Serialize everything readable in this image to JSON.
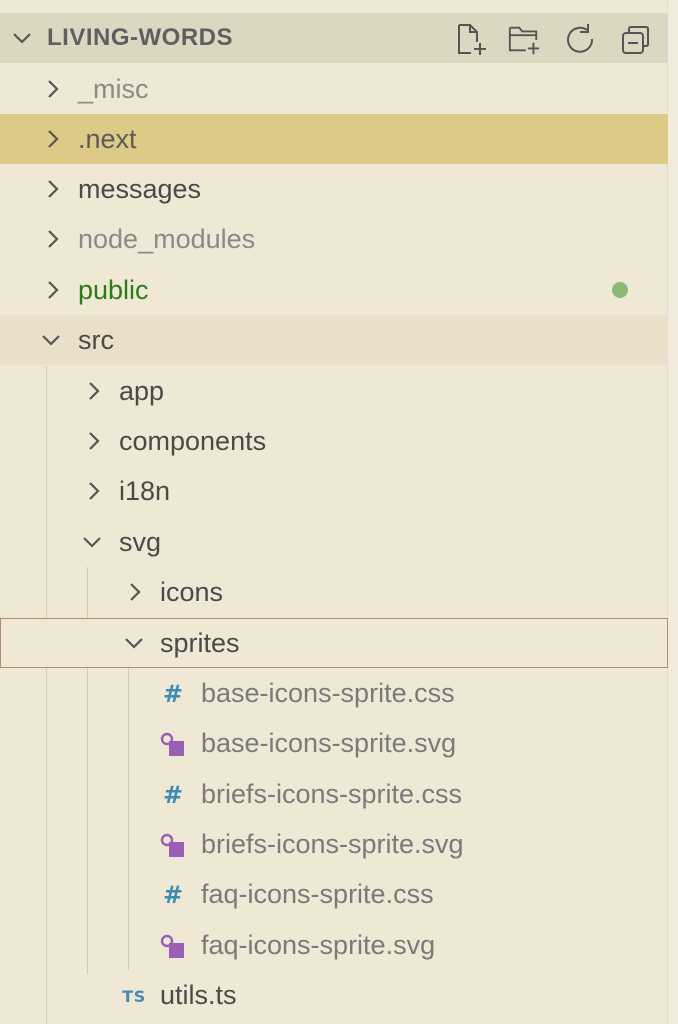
{
  "explorer": {
    "title": "LIVING-WORDS",
    "actions": [
      "new-file-icon",
      "new-folder-icon",
      "refresh-icon",
      "collapse-all-icon"
    ]
  },
  "tree": {
    "misc": "_misc",
    "next": ".next",
    "messages": "messages",
    "node_modules": "node_modules",
    "public": "public",
    "src": "src",
    "app": "app",
    "components": "components",
    "i18n": "i18n",
    "svg": "svg",
    "icons": "icons",
    "sprites": "sprites",
    "files": [
      {
        "name": "base-icons-sprite.css",
        "icon": "css-hash-icon"
      },
      {
        "name": "base-icons-sprite.svg",
        "icon": "svg-file-icon"
      },
      {
        "name": "briefs-icons-sprite.css",
        "icon": "css-hash-icon"
      },
      {
        "name": "briefs-icons-sprite.svg",
        "icon": "svg-file-icon"
      },
      {
        "name": "faq-icons-sprite.css",
        "icon": "css-hash-icon"
      },
      {
        "name": "faq-icons-sprite.svg",
        "icon": "svg-file-icon"
      }
    ],
    "utils": "utils.ts",
    "ts_badge": "TS",
    "css_glyph": "#"
  },
  "colors": {
    "background": "#efe8d4",
    "selected": "#ddca86",
    "modified_dot": "#8ab879",
    "public_label": "#2c7d18"
  }
}
